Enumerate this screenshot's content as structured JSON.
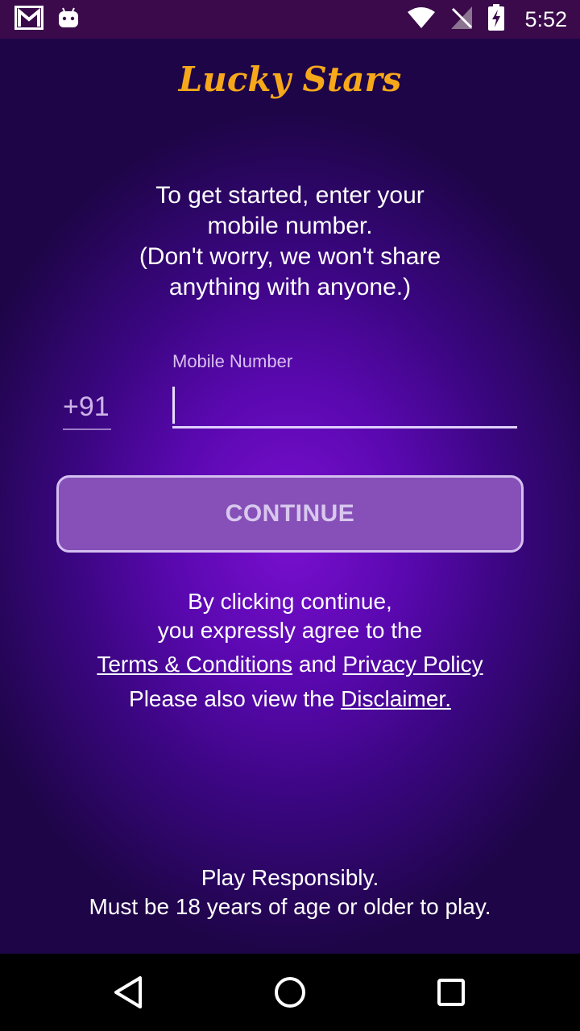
{
  "status_bar": {
    "time": "5:52",
    "icons": [
      "gmail-icon",
      "android-icon",
      "wifi-icon",
      "no-signal-icon",
      "battery-charging-icon"
    ]
  },
  "app": {
    "title": "Lucky Stars"
  },
  "intro": {
    "line1": "To get started, enter your",
    "line2": "mobile number.",
    "line3": "(Don't worry, we won't share",
    "line4": "anything with anyone.)"
  },
  "form": {
    "field_label": "Mobile Number",
    "country_code": "+91",
    "mobile_value": "",
    "continue_label": "CONTINUE"
  },
  "legal": {
    "line1": "By clicking continue,",
    "line2": "you expressly agree to the",
    "terms_link": "Terms & Conditions",
    "and_text": " and ",
    "privacy_link": "Privacy Policy",
    "also_view": "Please also view the ",
    "disclaimer_link": "Disclaimer."
  },
  "footer": {
    "line1": "Play Responsibly.",
    "line2": "Must be 18 years of age or older to play."
  },
  "colors": {
    "title": "#f7a81a",
    "status_bar": "#3a0a4a",
    "background": "#5a08b0",
    "button": "#8650b8"
  }
}
